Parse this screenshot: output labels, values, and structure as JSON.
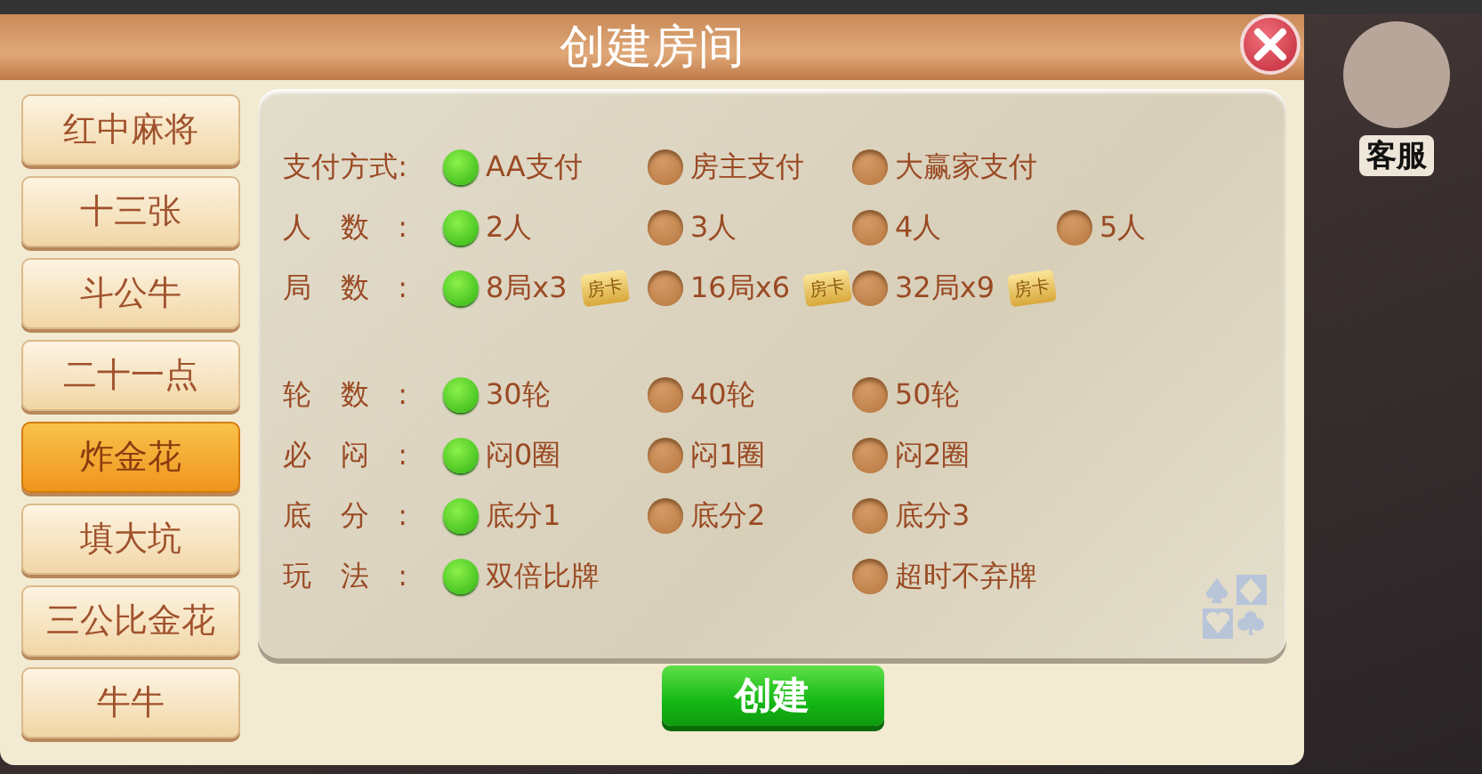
{
  "dialog": {
    "title": "创建房间"
  },
  "games": [
    {
      "label": "红中麻将",
      "selected": false
    },
    {
      "label": "十三张",
      "selected": false
    },
    {
      "label": "斗公牛",
      "selected": false
    },
    {
      "label": "二十一点",
      "selected": false
    },
    {
      "label": "炸金花",
      "selected": true
    },
    {
      "label": "填大坑",
      "selected": false
    },
    {
      "label": "三公比金花",
      "selected": false
    },
    {
      "label": "牛牛",
      "selected": false
    }
  ],
  "sections": [
    {
      "rows": [
        {
          "label": "支付方式:",
          "wide": false,
          "options": [
            {
              "label": "AA支付",
              "selected": true
            },
            {
              "label": "房主支付",
              "selected": false
            },
            {
              "label": "大赢家支付",
              "selected": false
            }
          ]
        },
        {
          "label": "人数:",
          "wide": false,
          "options": [
            {
              "label": "2人",
              "selected": true
            },
            {
              "label": "3人",
              "selected": false
            },
            {
              "label": "4人",
              "selected": false
            },
            {
              "label": "5人",
              "selected": false
            }
          ]
        },
        {
          "label": "局数:",
          "wide": false,
          "options": [
            {
              "label": "8局x3",
              "selected": true,
              "card": "房卡"
            },
            {
              "label": "16局x6",
              "selected": false,
              "card": "房卡"
            },
            {
              "label": "32局x9",
              "selected": false,
              "card": "房卡"
            }
          ]
        }
      ]
    },
    {
      "rows": [
        {
          "label": "轮数:",
          "wide": false,
          "options": [
            {
              "label": "30轮",
              "selected": true
            },
            {
              "label": "40轮",
              "selected": false
            },
            {
              "label": "50轮",
              "selected": false
            }
          ]
        },
        {
          "label": "必闷:",
          "wide": false,
          "options": [
            {
              "label": "闷0圈",
              "selected": true
            },
            {
              "label": "闷1圈",
              "selected": false
            },
            {
              "label": "闷2圈",
              "selected": false
            }
          ]
        },
        {
          "label": "底分:",
          "wide": false,
          "options": [
            {
              "label": "底分1",
              "selected": true
            },
            {
              "label": "底分2",
              "selected": false
            },
            {
              "label": "底分3",
              "selected": false
            }
          ]
        },
        {
          "label": "玩法:",
          "wide": true,
          "options": [
            {
              "label": "双倍比牌",
              "selected": true
            },
            {
              "label": "超时不弃牌",
              "selected": false
            }
          ]
        }
      ]
    }
  ],
  "create_button": "创建",
  "support": {
    "label": "客服"
  }
}
